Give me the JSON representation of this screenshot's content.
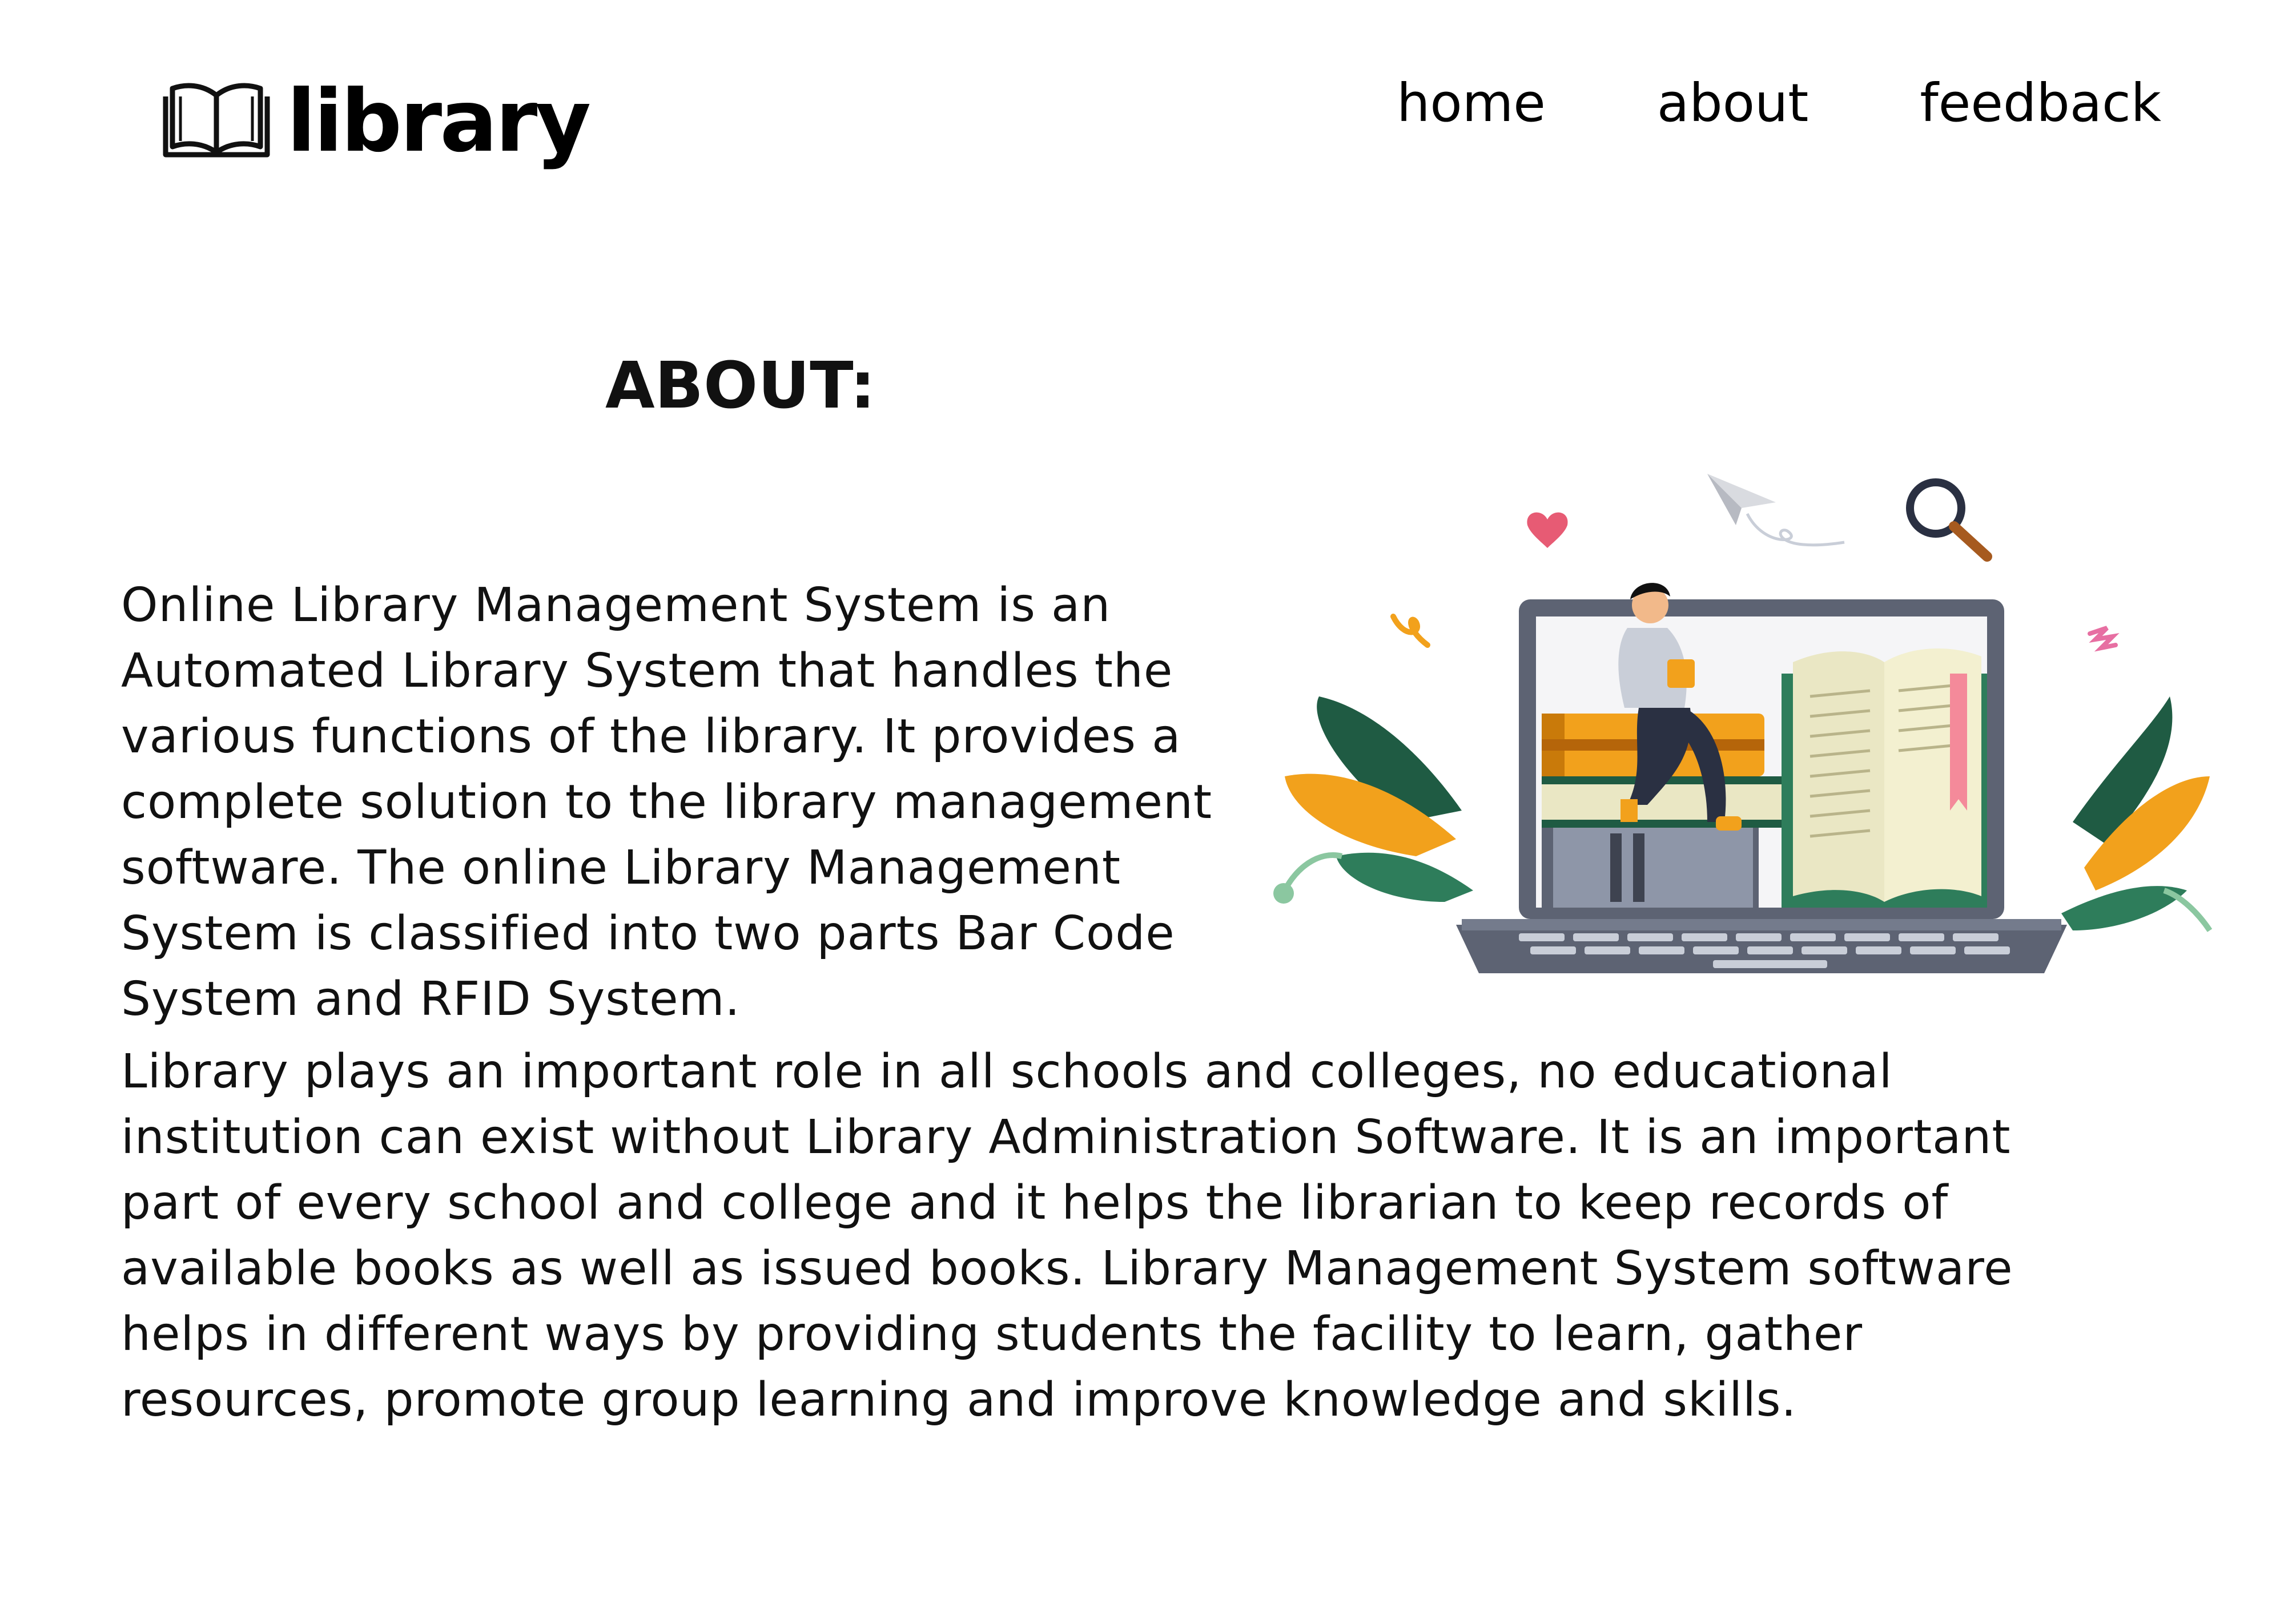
{
  "brand": {
    "name": "library",
    "icon": "open-book-icon"
  },
  "nav": {
    "items": [
      {
        "label": "home"
      },
      {
        "label": "about"
      },
      {
        "label": "feedback"
      }
    ]
  },
  "main": {
    "heading": "ABOUT:",
    "paragraphs": [
      "Online Library Management System is an Automated Library System that handles the various functions of the library. It provides a complete solution to the library management software. The online Library Management System is classified into two parts Bar Code System and RFID System.",
      "Library plays an important role in all schools and colleges, no educational institution can exist without Library Administration Software. It is an important part of every school and college and it helps the librarian to keep records of available books as well as issued books. Library Management System software helps in different ways by providing students the facility to learn, gather resources, promote group learning and improve knowledge and skills."
    ],
    "illustration": "person-reading-on-laptop-with-books-illustration"
  },
  "colors": {
    "text": "#111111",
    "background": "#ffffff",
    "orange": "#f2a11c",
    "dark_green": "#1f5b43",
    "laptop_gray": "#5d6373"
  }
}
